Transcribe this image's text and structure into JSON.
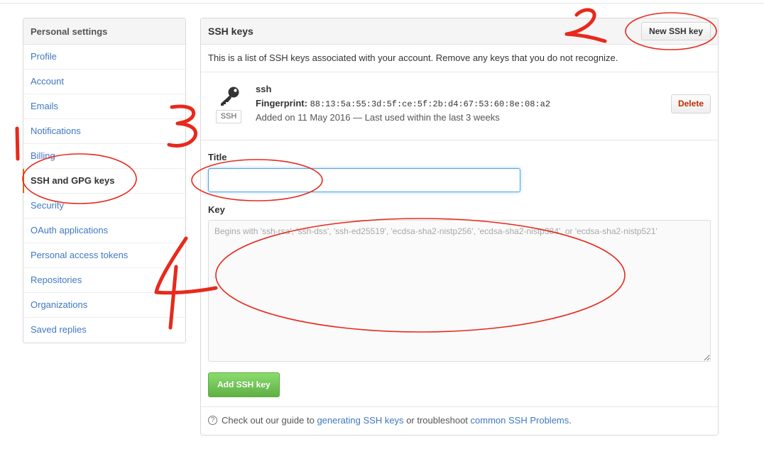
{
  "sidebar": {
    "header": "Personal settings",
    "items": [
      {
        "label": "Profile"
      },
      {
        "label": "Account"
      },
      {
        "label": "Emails"
      },
      {
        "label": "Notifications"
      },
      {
        "label": "Billing"
      },
      {
        "label": "SSH and GPG keys",
        "selected": true
      },
      {
        "label": "Security"
      },
      {
        "label": "OAuth applications"
      },
      {
        "label": "Personal access tokens"
      },
      {
        "label": "Repositories"
      },
      {
        "label": "Organizations"
      },
      {
        "label": "Saved replies"
      }
    ]
  },
  "panel": {
    "title": "SSH keys",
    "new_key_button": "New SSH key",
    "intro": "This is a list of SSH keys associated with your account. Remove any keys that you do not recognize.",
    "key": {
      "name": "ssh",
      "badge": "SSH",
      "fingerprint_label": "Fingerprint:",
      "fingerprint": "88:13:5a:55:3d:5f:ce:5f:2b:d4:67:53:60:8e:08:a2",
      "added": "Added on 11 May 2016 — Last used within the last 3 weeks",
      "delete_button": "Delete"
    },
    "form": {
      "title_label": "Title",
      "title_value": "",
      "key_label": "Key",
      "key_placeholder": "Begins with 'ssh-rsa', 'ssh-dss', 'ssh-ed25519', 'ecdsa-sha2-nistp256', 'ecdsa-sha2-nistp384', or 'ecdsa-sha2-nistp521'",
      "add_button": "Add SSH key"
    },
    "footer": {
      "help_icon": "question-icon",
      "text_1": "Check out our guide to",
      "link_1": "generating SSH keys",
      "text_2": "or troubleshoot",
      "link_2": "common SSH Problems",
      "text_3": "."
    }
  },
  "annotations": {
    "color": "#e8291c",
    "labels": [
      "1",
      "2",
      "3",
      "4"
    ]
  }
}
